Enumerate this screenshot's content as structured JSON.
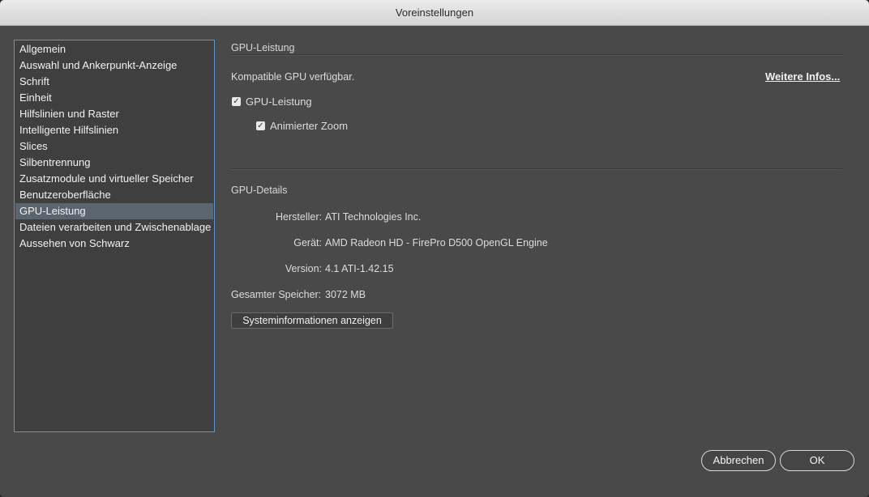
{
  "window": {
    "title": "Voreinstellungen"
  },
  "sidebar": {
    "items": [
      {
        "label": "Allgemein"
      },
      {
        "label": "Auswahl und Ankerpunkt-Anzeige"
      },
      {
        "label": "Schrift"
      },
      {
        "label": "Einheit"
      },
      {
        "label": "Hilfslinien und Raster"
      },
      {
        "label": "Intelligente Hilfslinien"
      },
      {
        "label": "Slices"
      },
      {
        "label": "Silbentrennung"
      },
      {
        "label": "Zusatzmodule und virtueller Speicher"
      },
      {
        "label": "Benutzeroberfläche"
      },
      {
        "label": "GPU-Leistung",
        "selected": true
      },
      {
        "label": "Dateien verarbeiten und Zwischenablage"
      },
      {
        "label": "Aussehen von Schwarz"
      }
    ]
  },
  "gpu": {
    "section_title": "GPU-Leistung",
    "status": "Kompatible GPU verfügbar.",
    "more_info_link": "Weitere Infos...",
    "gpu_checkbox": {
      "label": "GPU-Leistung",
      "checked": true
    },
    "zoom_checkbox": {
      "label": "Animierter Zoom",
      "checked": true
    }
  },
  "details": {
    "section_title": "GPU-Details",
    "vendor_label": "Hersteller:",
    "vendor_value": "ATI Technologies Inc.",
    "device_label": "Gerät:",
    "device_value": "AMD Radeon HD - FirePro D500 OpenGL Engine",
    "version_label": "Version:",
    "version_value": "4.1 ATI-1.42.15",
    "memory_label": "Gesamter Speicher:",
    "memory_value": "3072 MB",
    "sysinfo_button": "Systeminformationen anzeigen"
  },
  "footer": {
    "cancel_label": "Abbrechen",
    "ok_label": "OK"
  },
  "colors": {
    "panel_bg": "#494949",
    "selection": "#5a6570",
    "list_border": "#5f95c8"
  },
  "icons": {
    "checkbox": "checkmark-icon"
  }
}
